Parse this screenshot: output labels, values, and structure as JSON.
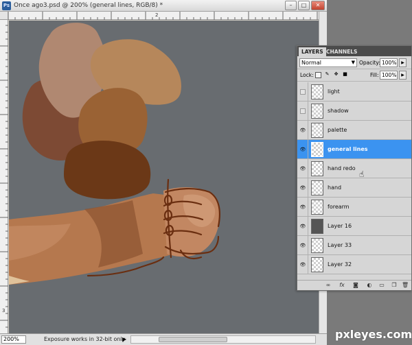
{
  "window": {
    "app_badge": "Ps",
    "title": "Once ago3.psd @ 200% (general lines, RGB/8) *",
    "btn_minimize": "–",
    "btn_restore": "□",
    "btn_close": "✕"
  },
  "rulers": {
    "top_label": "2",
    "left_label": "3"
  },
  "status": {
    "zoom": "200%",
    "message": "Exposure works in 32-bit only",
    "arrow": "▶"
  },
  "layers_panel": {
    "tabs": [
      "LAYERS",
      "CHANNELS"
    ],
    "blend_mode": "Normal",
    "opacity_label": "Opacity:",
    "opacity": "100%",
    "lock_label": "Lock:",
    "fill_label": "Fill:",
    "fill": "100%",
    "layers": [
      {
        "name": "light",
        "visible": false,
        "selected": false,
        "thumb": "transparent"
      },
      {
        "name": "shadow",
        "visible": false,
        "selected": false,
        "thumb": "transparent"
      },
      {
        "name": "palette",
        "visible": true,
        "selected": false,
        "thumb": "transparent"
      },
      {
        "name": "general lines",
        "visible": true,
        "selected": true,
        "thumb": "transparent"
      },
      {
        "name": "hand redo",
        "visible": true,
        "selected": false,
        "thumb": "transparent"
      },
      {
        "name": "hand",
        "visible": true,
        "selected": false,
        "thumb": "transparent"
      },
      {
        "name": "forearm",
        "visible": true,
        "selected": false,
        "thumb": "transparent"
      },
      {
        "name": "Layer 16",
        "visible": true,
        "selected": false,
        "thumb": "gray"
      },
      {
        "name": "Layer 33",
        "visible": true,
        "selected": false,
        "thumb": "transparent"
      },
      {
        "name": "Layer 32",
        "visible": true,
        "selected": false,
        "thumb": "transparent"
      }
    ],
    "bottom_icons": [
      "link-icon",
      "fx-icon",
      "mask-icon",
      "adjustment-icon",
      "group-icon",
      "new-layer-icon",
      "trash-icon"
    ]
  },
  "watermark": "pxleyes.com",
  "colors": {
    "canvas_bg": "#686c70",
    "selection": "#3b93f0",
    "swatch1": "#b08871",
    "swatch2": "#b6875b",
    "swatch3": "#7d4a34",
    "swatch4": "#9a6234",
    "swatch5": "#6b3817"
  }
}
